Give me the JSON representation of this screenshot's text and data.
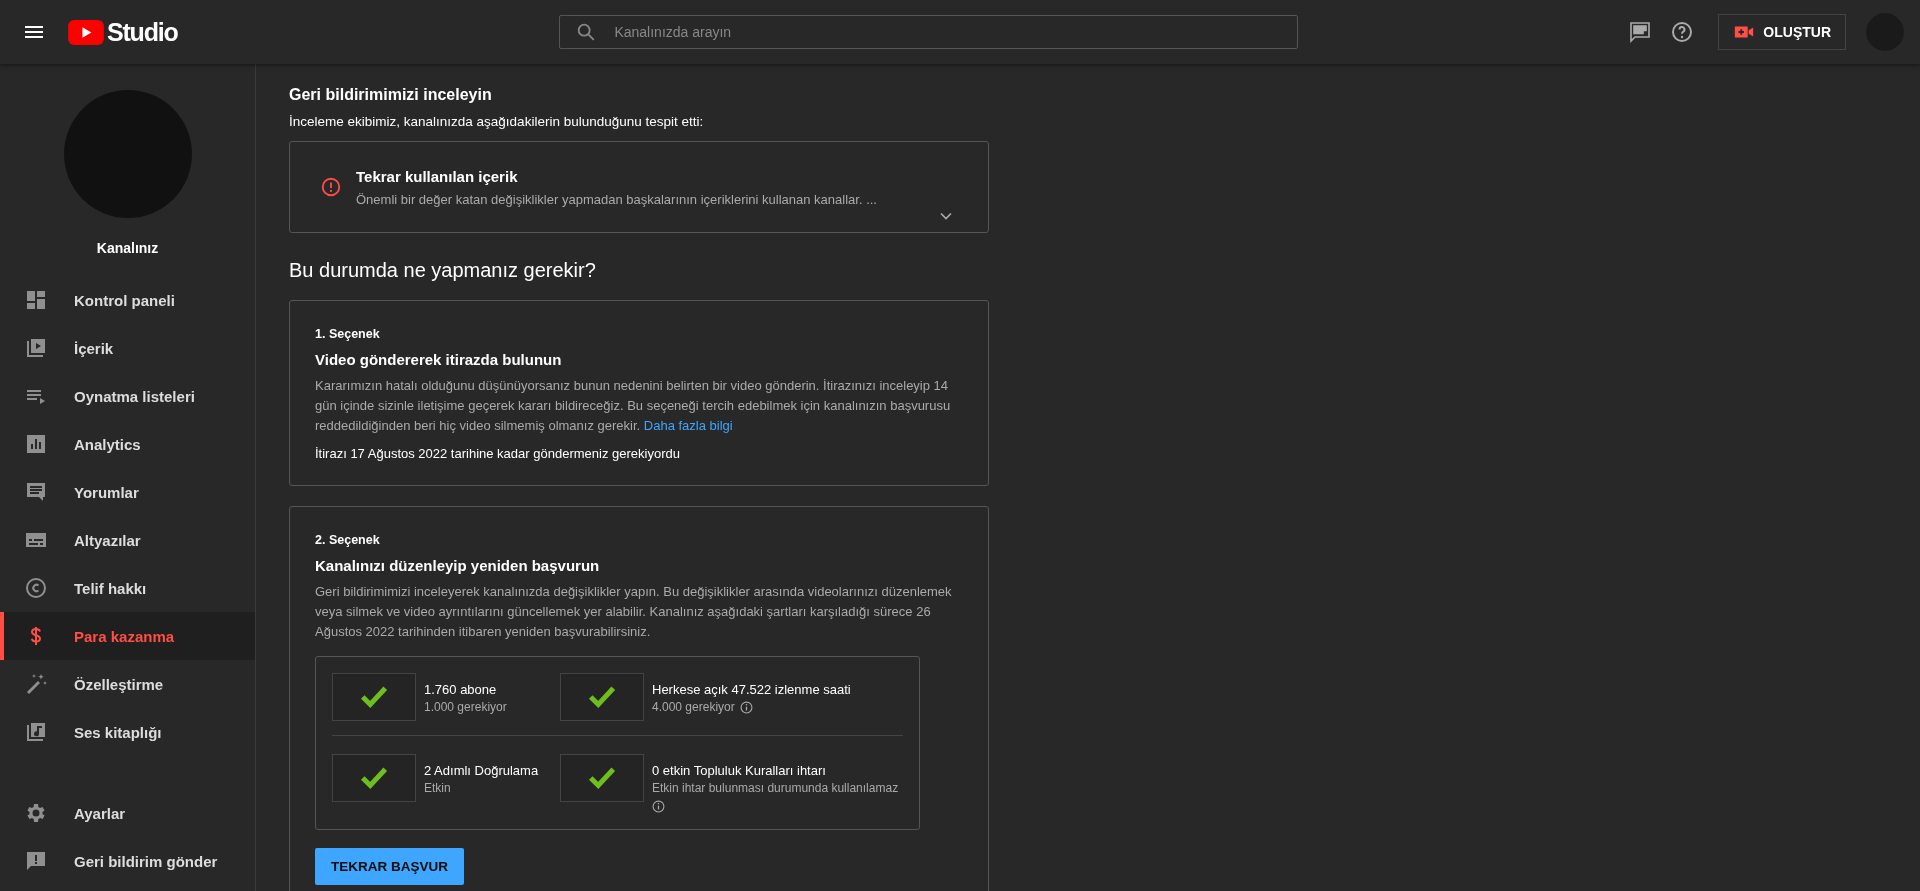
{
  "header": {
    "logo_text": "Studio",
    "search_placeholder": "Kanalınızda arayın",
    "create_button": "OLUŞTUR"
  },
  "sidebar": {
    "channel_name": "Kanalınız",
    "items": [
      {
        "label": "Kontrol paneli",
        "selected": false
      },
      {
        "label": "İçerik",
        "selected": false
      },
      {
        "label": "Oynatma listeleri",
        "selected": false
      },
      {
        "label": "Analytics",
        "selected": false
      },
      {
        "label": "Yorumlar",
        "selected": false
      },
      {
        "label": "Altyazılar",
        "selected": false
      },
      {
        "label": "Telif hakkı",
        "selected": false
      },
      {
        "label": "Para kazanma",
        "selected": true
      },
      {
        "label": "Özelleştirme",
        "selected": false
      },
      {
        "label": "Ses kitaplığı",
        "selected": false
      }
    ],
    "footer_items": [
      {
        "label": "Ayarlar"
      },
      {
        "label": "Geri bildirim gönder"
      }
    ]
  },
  "feedback": {
    "title": "Geri bildirimimizi inceleyin",
    "intro": "İnceleme ekibimiz, kanalınızda aşağıdakilerin bulunduğunu tespit etti:",
    "issues": [
      {
        "title": "Tekrar kullanılan içerik",
        "description": "Önemli bir değer katan değişiklikler yapmadan başkalarının içeriklerini kullanan kanallar. ...",
        "expanded": false
      }
    ]
  },
  "section_title": "Bu durumda ne yapmanız gerekir?",
  "options": [
    {
      "label": "1. Seçenek",
      "title": "Video göndererek itirazda bulunun",
      "body": "Kararımızın hatalı olduğunu düşünüyorsanız bunun nedenini belirten bir video gönderin. İtirazınızı inceleyip 14 gün içinde sizinle iletişime geçerek kararı bildireceğiz. Bu seçeneği tercih edebilmek için kanalınızın başvurusu reddedildiğinden beri hiç video silmemiş olmanız gerekir.",
      "link": "Daha fazla bilgi",
      "deadline": "İtirazı 17 Ağustos 2022 tarihine kadar göndermeniz gerekiyordu"
    },
    {
      "label": "2. Seçenek",
      "title": "Kanalınızı düzenleyip yeniden başvurun",
      "body": "Geri bildirimimizi inceleyerek kanalınızda değişiklikler yapın. Bu değişiklikler arasında videolarınızı düzenlemek veya silmek ve video ayrıntılarını güncellemek yer alabilir. Kanalınız aşağıdaki şartları karşıladığı sürece 26 Ağustos 2022 tarihinden itibaren yeniden başvurabilirsiniz.",
      "requirements": [
        {
          "title": "1.760 abone",
          "note": "1.000 gerekiyor",
          "met": true,
          "info": false
        },
        {
          "title": "Herkese açık 47.522 izlenme saati",
          "note": "4.000 gerekiyor",
          "met": true,
          "info": true
        },
        {
          "title": "2 Adımlı Doğrulama",
          "note": "Etkin",
          "met": true,
          "info": false
        },
        {
          "title": "0 etkin Topluluk Kuralları ihtarı",
          "note": "Etkin ihtar bulunması durumunda kullanılamaz",
          "met": true,
          "info": true
        }
      ],
      "button": "TEKRAR BAŞVUR"
    }
  ]
}
